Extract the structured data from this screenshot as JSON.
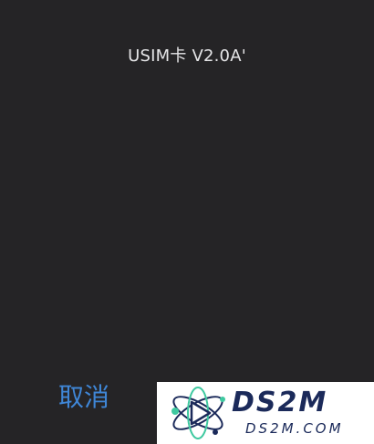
{
  "dialog": {
    "title": "USIM卡 V2.0A'",
    "cancel_label": "取消"
  },
  "watermark": {
    "brand": "DS2M",
    "domain": "DS2M.COM"
  },
  "colors": {
    "background": "#252426",
    "title_text": "#e6e6e8",
    "action_blue": "#3f86d6",
    "watermark_bg": "#ffffff",
    "watermark_text": "#1b2a5a",
    "watermark_accent": "#3fc9a0"
  }
}
